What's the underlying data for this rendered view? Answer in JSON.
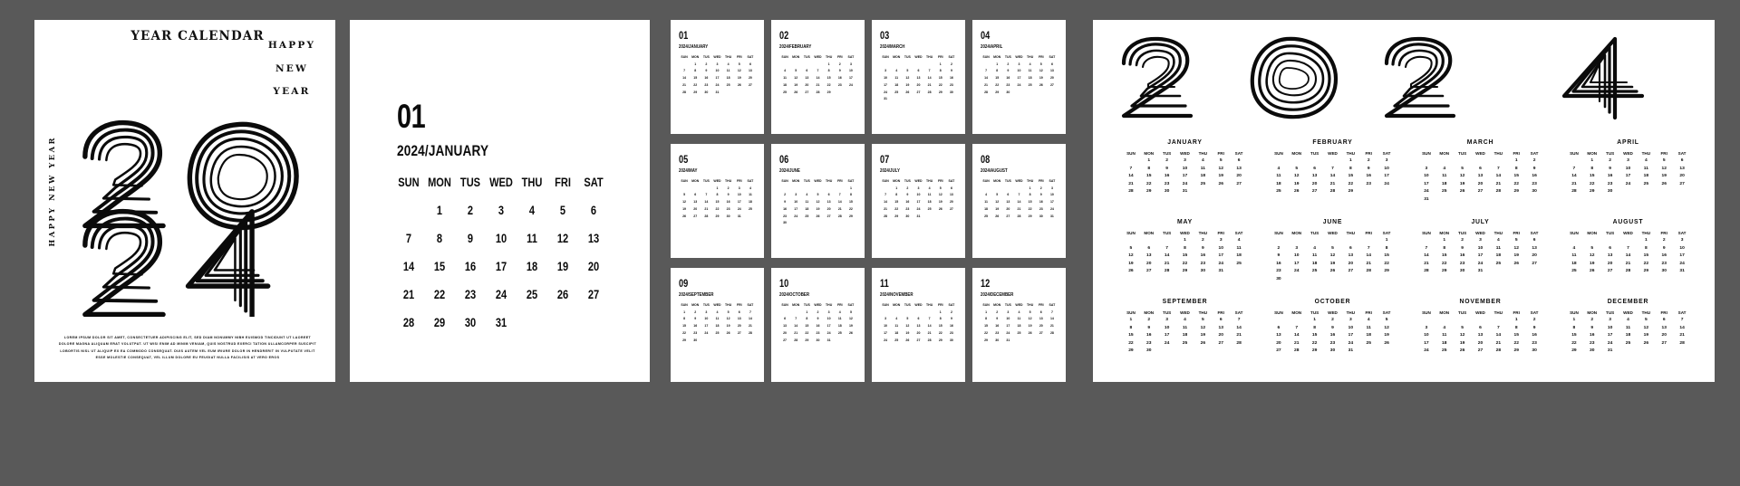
{
  "theme": {
    "background": "#595959",
    "paper": "#ffffff",
    "ink": "#0b0b0b"
  },
  "cover": {
    "title": "YEAR CALENDAR",
    "happy_new_year_stack": [
      "HAPPY",
      "NEW",
      "YEAR"
    ],
    "vertical_text": "HAPPY NEW YEAR",
    "year_art": "2024",
    "year_art_rows": [
      "20",
      "24"
    ],
    "lorem": "LOREM IPSUM DOLOR SIT AMET, CONSECTETUER ADIPISCING ELIT, SED DIAM NONUMMY NIBH EUISMOD TINCIDUNT UT LAOREET DOLORE MAGNA ALIQUAM ERAT VOLUTPAT. UT WISI ENIM AD MINIM VENIAM, QUIS NOSTRUD EXERCI TATION ULLAMCORPER SUSCIPIT LOBORTIS NISL UT ALIQUIP EX EA COMMODO CONSEQUAT. DUIS AUTEM VEL EUM IRIURE DOLOR IN HENDRERIT IN VULPUTATE VELIT ESSE MOLESTIE CONSEQUAT, VEL ILLUM DOLORE EU FEUGIAT NULLA FACILISIS AT VERO EROS"
  },
  "weekdays": [
    "SUN",
    "MON",
    "TUS",
    "WED",
    "THU",
    "FRI",
    "SAT"
  ],
  "month_panel": {
    "number": "01",
    "subtitle": "2024/JANUARY",
    "lead_blanks": 1,
    "days": 31
  },
  "year_label": "2024",
  "months": [
    {
      "number": "01",
      "name": "JANUARY",
      "subtitle": "2024/JANUARY",
      "lead_blanks": 1,
      "days": 31
    },
    {
      "number": "02",
      "name": "FEBRUARY",
      "subtitle": "2024/FEBRUARY",
      "lead_blanks": 4,
      "days": 29
    },
    {
      "number": "03",
      "name": "MARCH",
      "subtitle": "2024/MARCH",
      "lead_blanks": 5,
      "days": 31
    },
    {
      "number": "04",
      "name": "APRIL",
      "subtitle": "2024/APRIL",
      "lead_blanks": 1,
      "days": 30
    },
    {
      "number": "05",
      "name": "MAY",
      "subtitle": "2024/MAY",
      "lead_blanks": 3,
      "days": 31
    },
    {
      "number": "06",
      "name": "JUNE",
      "subtitle": "2024/JUNE",
      "lead_blanks": 6,
      "days": 30
    },
    {
      "number": "07",
      "name": "JULY",
      "subtitle": "2024/JULY",
      "lead_blanks": 1,
      "days": 31
    },
    {
      "number": "08",
      "name": "AUGUST",
      "subtitle": "2024/AUGUST",
      "lead_blanks": 4,
      "days": 31
    },
    {
      "number": "09",
      "name": "SEPTEMBER",
      "subtitle": "2024/SEPTEMBER",
      "lead_blanks": 0,
      "days": 30
    },
    {
      "number": "10",
      "name": "OCTOBER",
      "subtitle": "2024/OCTOBER",
      "lead_blanks": 2,
      "days": 31
    },
    {
      "number": "11",
      "name": "NOVEMBER",
      "subtitle": "2024/NOVEMBER",
      "lead_blanks": 5,
      "days": 30
    },
    {
      "number": "12",
      "name": "DECEMBER",
      "subtitle": "2024/DECEMBER",
      "lead_blanks": 0,
      "days": 31
    }
  ]
}
